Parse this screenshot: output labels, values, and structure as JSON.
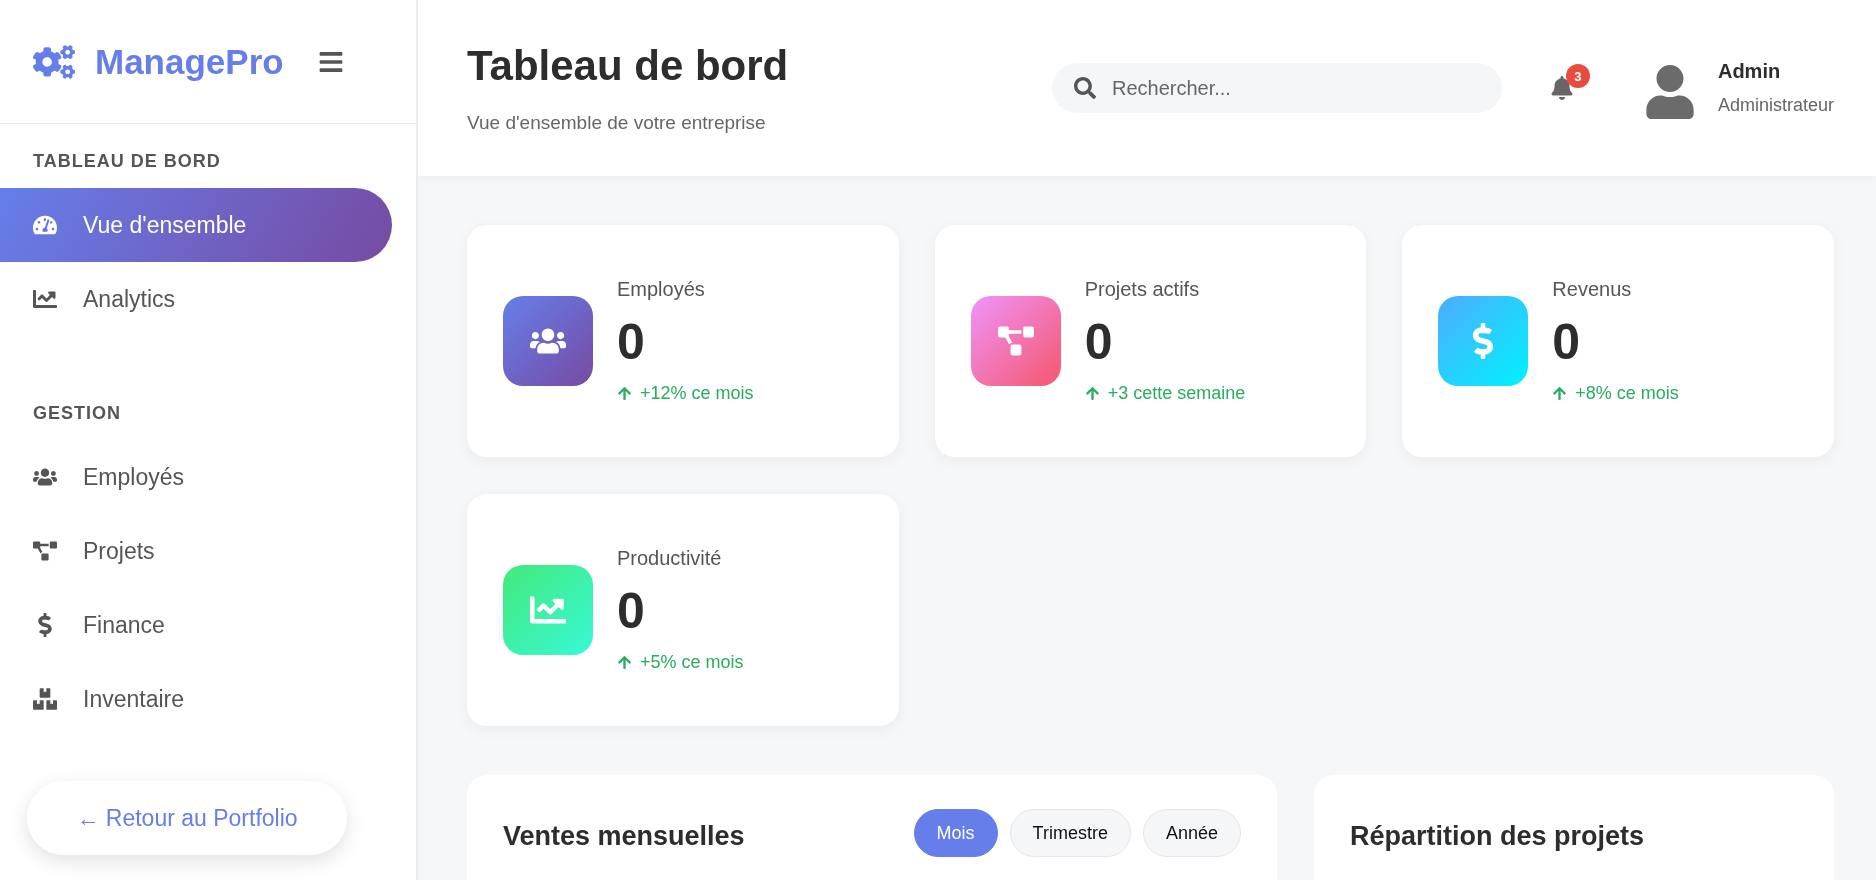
{
  "sidebar": {
    "brand": "ManagePro",
    "sections": [
      {
        "title": "TABLEAU DE BORD",
        "items": [
          {
            "label": "Vue d'ensemble",
            "selected": true
          },
          {
            "label": "Analytics",
            "selected": false
          }
        ]
      },
      {
        "title": "GESTION",
        "items": [
          {
            "label": "Employés",
            "selected": false
          },
          {
            "label": "Projets",
            "selected": false
          },
          {
            "label": "Finance",
            "selected": false
          },
          {
            "label": "Inventaire",
            "selected": false
          }
        ]
      }
    ]
  },
  "back_link": "← Retour au Portfolio",
  "header": {
    "title": "Tableau de bord",
    "subtitle": "Vue d'ensemble de votre entreprise",
    "search": {
      "placeholder": "Rechercher..."
    },
    "notifications": "3",
    "user": {
      "name": "Admin",
      "role": "Administrateur"
    }
  },
  "stats": [
    {
      "label": "Employés",
      "value": "0",
      "trend": "+12% ce mois"
    },
    {
      "label": "Projets actifs",
      "value": "0",
      "trend": "+3 cette semaine"
    },
    {
      "label": "Revenus",
      "value": "0",
      "trend": "+8% ce mois"
    },
    {
      "label": "Productivité",
      "value": "0",
      "trend": "+5% ce mois"
    }
  ],
  "panels": [
    {
      "title": "Ventes mensuelles",
      "filters": [
        {
          "label": "Mois",
          "selected": true
        },
        {
          "label": "Trimestre",
          "selected": false
        },
        {
          "label": "Année",
          "selected": false
        }
      ]
    },
    {
      "title": "Répartition des projets"
    }
  ]
}
